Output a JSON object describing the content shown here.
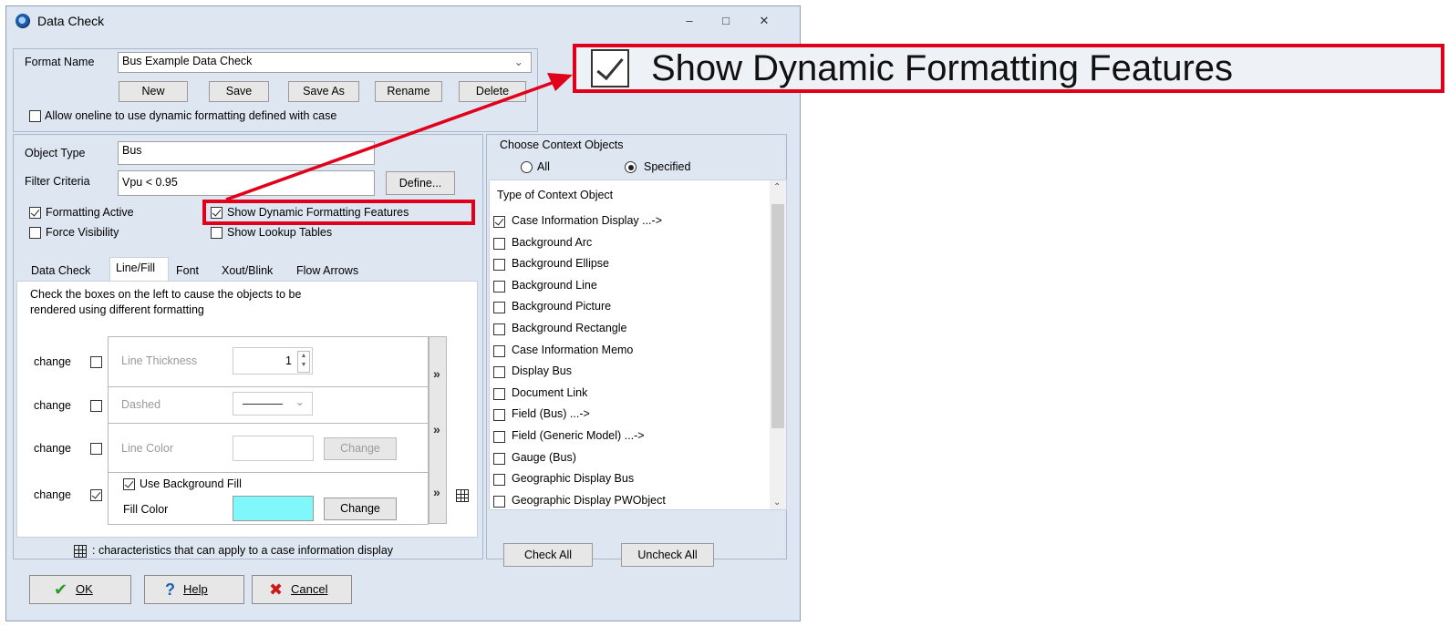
{
  "window": {
    "title": "Data Check",
    "controls": {
      "minimize": "–",
      "maximize": "□",
      "close": "✕"
    }
  },
  "format": {
    "label": "Format Name",
    "value": "Bus Example Data Check",
    "buttons": [
      "New",
      "Save",
      "Save As",
      "Rename",
      "Delete"
    ],
    "allow_oneline_label": "Allow oneline to use dynamic formatting defined with case",
    "allow_oneline_checked": false
  },
  "object": {
    "type_label": "Object Type",
    "type_value": "Bus",
    "filter_label": "Filter Criteria",
    "filter_value": "Vpu < 0.95",
    "define_button": "Define...",
    "formatting_active_label": "Formatting Active",
    "formatting_active_checked": true,
    "force_visibility_label": "Force Visibility",
    "force_visibility_checked": false,
    "show_dynamic_label": "Show Dynamic Formatting Features",
    "show_dynamic_checked": true,
    "show_lookup_label": "Show Lookup Tables",
    "show_lookup_checked": false
  },
  "tabs": [
    "Data Check",
    "Line/Fill",
    "Font",
    "Xout/Blink",
    "Flow Arrows"
  ],
  "active_tab": "Line/Fill",
  "linefill": {
    "instructions_line1": "Check the boxes on the left to cause the objects to be",
    "instructions_line2": "rendered using different formatting",
    "change_label": "change",
    "line_thickness_label": "Line Thickness",
    "line_thickness_value": "1",
    "dashed_label": "Dashed",
    "line_color_label": "Line Color",
    "change_button": "Change",
    "use_bg_fill_label": "Use Background Fill",
    "use_bg_fill_checked": true,
    "fill_color_label": "Fill Color",
    "fill_color": "#7ff7fb",
    "change_checked": [
      false,
      false,
      false,
      true
    ],
    "arrow_glyph": "»",
    "legend_text": ": characteristics that can apply to a case information display"
  },
  "context": {
    "title": "Choose Context Objects",
    "radio_all": "All",
    "radio_specified": "Specified",
    "selected": "Specified",
    "list_header": "Type of Context Object",
    "items": [
      {
        "label": "Case Information Display ...->",
        "checked": true
      },
      {
        "label": "Background Arc",
        "checked": false
      },
      {
        "label": "Background Ellipse",
        "checked": false
      },
      {
        "label": "Background Line",
        "checked": false
      },
      {
        "label": "Background Picture",
        "checked": false
      },
      {
        "label": "Background Rectangle",
        "checked": false
      },
      {
        "label": "Case Information Memo",
        "checked": false
      },
      {
        "label": "Display Bus",
        "checked": false
      },
      {
        "label": "Document Link",
        "checked": false
      },
      {
        "label": "Field (Bus) ...->",
        "checked": false
      },
      {
        "label": "Field (Generic Model) ...->",
        "checked": false
      },
      {
        "label": "Gauge (Bus)",
        "checked": false
      },
      {
        "label": "Geographic Display Bus",
        "checked": false
      },
      {
        "label": "Geographic Display PWObject",
        "checked": false
      }
    ],
    "check_all": "Check All",
    "uncheck_all": "Uncheck All"
  },
  "footer": {
    "ok": "OK",
    "help": "Help",
    "cancel": "Cancel"
  },
  "callout": {
    "text": "Show Dynamic Formatting Features",
    "checked": true
  },
  "colors": {
    "dialog_bg": "#dde6f1",
    "highlight_red": "#e0001a",
    "ok_green": "#2c9a2c",
    "help_blue": "#1e5fb4",
    "cancel_red": "#cc1a1a"
  }
}
